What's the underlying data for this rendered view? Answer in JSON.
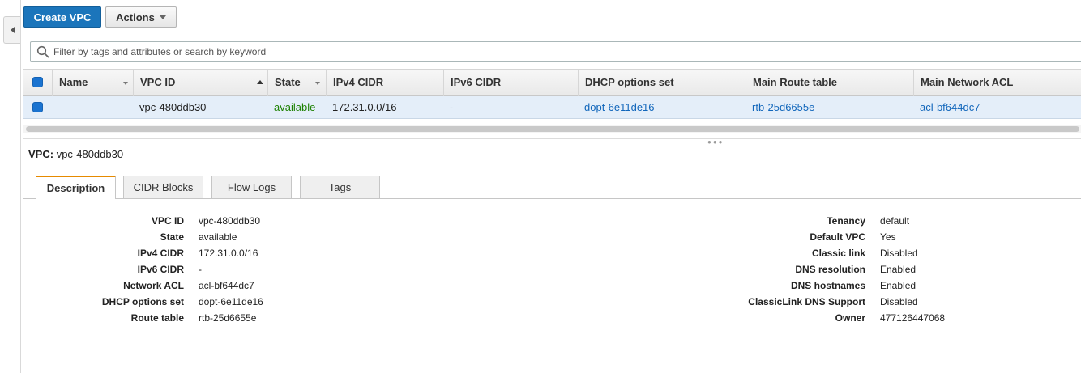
{
  "sidebar": {
    "collapse_icon": "chevron-left-icon"
  },
  "toolbar": {
    "create_label": "Create VPC",
    "actions_label": "Actions"
  },
  "filter": {
    "placeholder": "Filter by tags and attributes or search by keyword",
    "value": ""
  },
  "table": {
    "headers": [
      "Name",
      "VPC ID",
      "State",
      "IPv4 CIDR",
      "IPv6 CIDR",
      "DHCP options set",
      "Main Route table",
      "Main Network ACL"
    ],
    "rows": [
      {
        "name": "",
        "vpc_id": "vpc-480ddb30",
        "state": "available",
        "ipv4": "172.31.0.0/16",
        "ipv6": "-",
        "dhcp": "dopt-6e11de16",
        "route_table": "rtb-25d6655e",
        "network_acl": "acl-bf644dc7"
      }
    ]
  },
  "detail": {
    "title_label": "VPC:",
    "title_value": "vpc-480ddb30",
    "tabs": [
      "Description",
      "CIDR Blocks",
      "Flow Logs",
      "Tags"
    ],
    "left": [
      {
        "label": "VPC ID",
        "value": "vpc-480ddb30"
      },
      {
        "label": "State",
        "value": "available"
      },
      {
        "label": "IPv4 CIDR",
        "value": "172.31.0.0/16"
      },
      {
        "label": "IPv6 CIDR",
        "value": "-"
      },
      {
        "label": "Network ACL",
        "value": "acl-bf644dc7"
      },
      {
        "label": "DHCP options set",
        "value": "dopt-6e11de16"
      },
      {
        "label": "Route table",
        "value": "rtb-25d6655e"
      }
    ],
    "right": [
      {
        "label": "Tenancy",
        "value": "default"
      },
      {
        "label": "Default VPC",
        "value": "Yes"
      },
      {
        "label": "Classic link",
        "value": "Disabled"
      },
      {
        "label": "DNS resolution",
        "value": "Enabled"
      },
      {
        "label": "DNS hostnames",
        "value": "Enabled"
      },
      {
        "label": "ClassicLink DNS Support",
        "value": "Disabled"
      },
      {
        "label": "Owner",
        "value": "477126447068"
      }
    ]
  },
  "colors": {
    "primary": "#1b75bb",
    "link": "#1166bb",
    "available": "#1d8102",
    "active_tab": "#e68a00",
    "selected_row": "#e4eef9"
  }
}
